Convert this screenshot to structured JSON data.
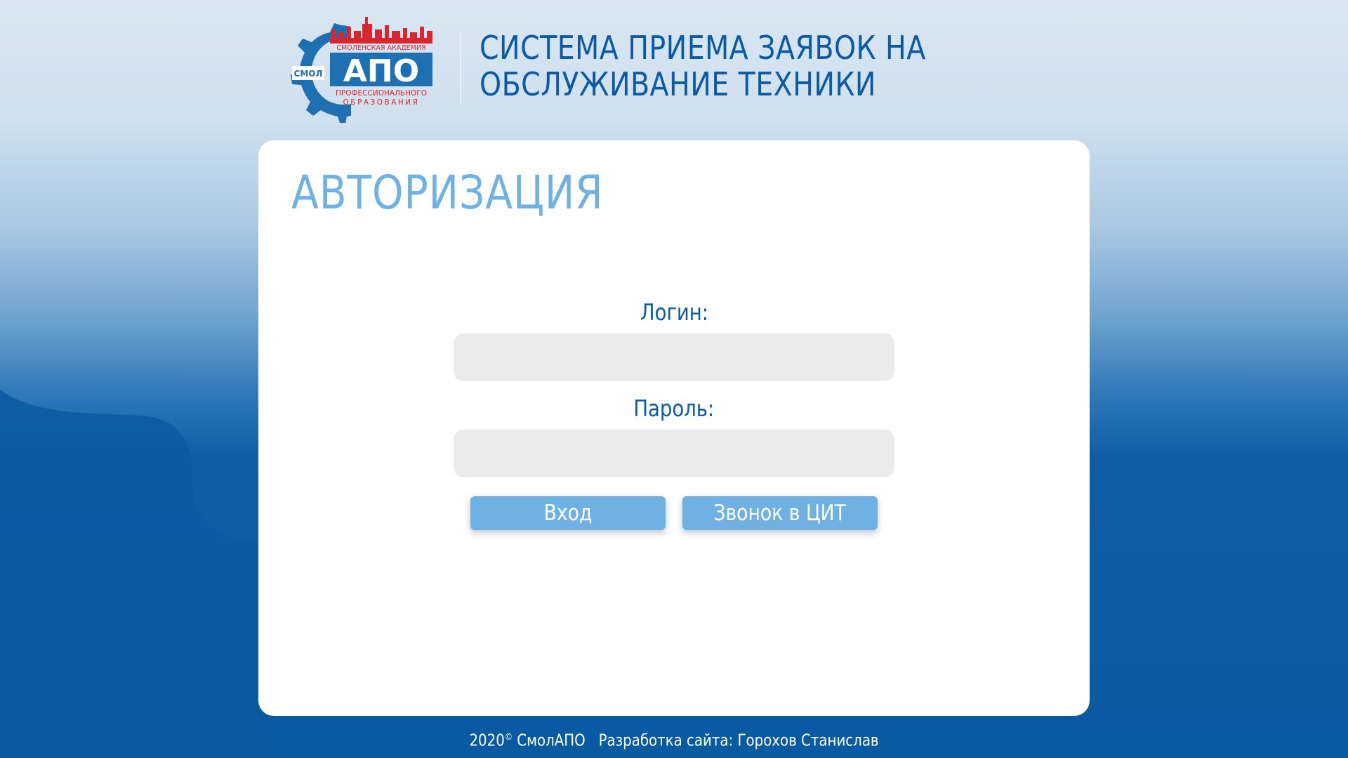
{
  "header": {
    "logo": {
      "small_label": "СМОЛ",
      "top_text": "СМОЛЕНСКАЯ АКАДЕМИЯ",
      "main_text": "АПО",
      "bottom_text_1": "ПРОФЕССИОНАЛЬНОГО",
      "bottom_text_2": "ОБРАЗОВАНИЯ"
    },
    "title_line_1": "СИСТЕМА ПРИЕМА ЗАЯВОК НА",
    "title_line_2": "ОБСЛУЖИВАНИЕ ТЕХНИКИ"
  },
  "auth": {
    "title": "АВТОРИЗАЦИЯ",
    "login_label": "Логин:",
    "login_value": "",
    "password_label": "Пароль:",
    "password_value": "",
    "login_button": "Вход",
    "call_button": "Звонок в ЦИТ"
  },
  "footer": {
    "year": "2020",
    "copyright_mark": "©",
    "org": "СмолАПО",
    "developer": "Разработка сайта: Горохов Станислав"
  },
  "colors": {
    "primary_dark": "#0b5aa3",
    "accent_light": "#6fb1e3",
    "logo_red": "#d7262d",
    "input_bg": "#ebebeb",
    "card_bg": "#ffffff"
  }
}
